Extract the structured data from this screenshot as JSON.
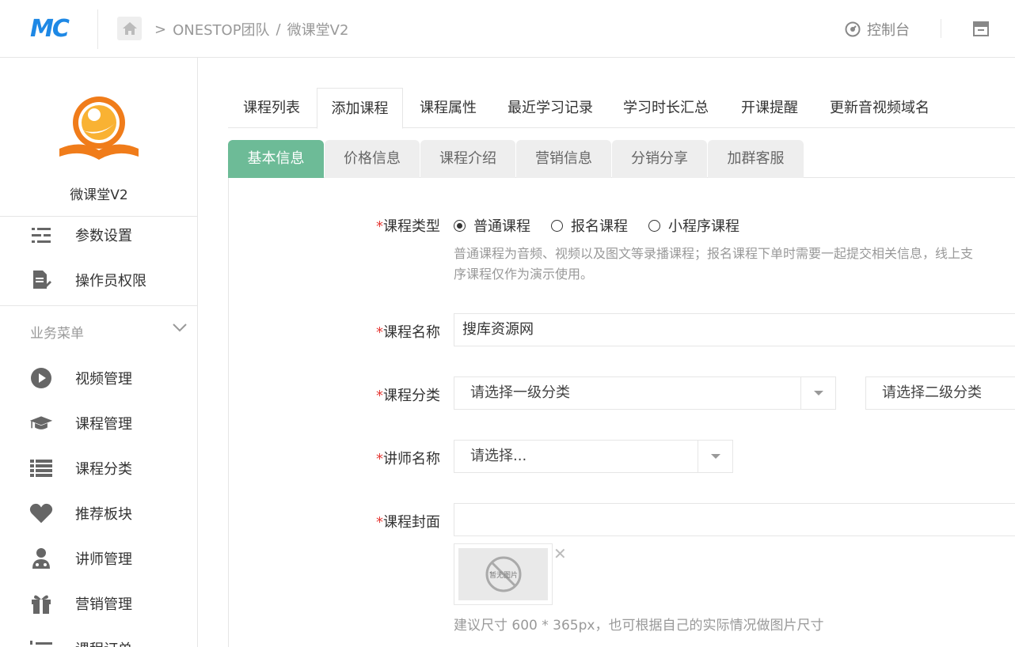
{
  "header": {
    "logo_text": "MC",
    "breadcrumb": [
      "ONESTOP团队",
      "微课堂V2"
    ],
    "breadcrumb_sep": ">",
    "breadcrumb_sep2": "/",
    "control_label": "控制台"
  },
  "sidebar": {
    "brand_name": "微课堂V2",
    "top_items": [
      {
        "label": "参数设置",
        "icon": "sliders-icon"
      },
      {
        "label": "操作员权限",
        "icon": "document-edit-icon"
      }
    ],
    "group_label": "业务菜单",
    "items": [
      {
        "label": "视频管理",
        "icon": "play-circle-icon"
      },
      {
        "label": "课程管理",
        "icon": "graduation-cap-icon"
      },
      {
        "label": "课程分类",
        "icon": "list-icon"
      },
      {
        "label": "推荐板块",
        "icon": "heart-icon"
      },
      {
        "label": "讲师管理",
        "icon": "teacher-icon"
      },
      {
        "label": "营销管理",
        "icon": "gift-icon"
      },
      {
        "label": "课程订单",
        "icon": "ordered-list-icon"
      }
    ]
  },
  "tabs": [
    "课程列表",
    "添加课程",
    "课程属性",
    "最近学习记录",
    "学习时长汇总",
    "开课提醒",
    "更新音视频域名"
  ],
  "active_tab": "添加课程",
  "subtabs": [
    "基本信息",
    "价格信息",
    "课程介绍",
    "营销信息",
    "分销分享",
    "加群客服"
  ],
  "active_subtab": "基本信息",
  "form": {
    "required_mark": "*",
    "type_label": "课程类型",
    "type_options": [
      "普通课程",
      "报名课程",
      "小程序课程"
    ],
    "type_selected": "普通课程",
    "type_help_1": "普通课程为音频、视频以及图文等录播课程；报名课程下单时需要一起提交相关信息，线上支",
    "type_help_2": "序课程仅作为演示使用。",
    "name_label": "课程名称",
    "name_value": "搜库资源网",
    "category_label": "课程分类",
    "category_1_placeholder": "请选择一级分类",
    "category_2_placeholder": "请选择二级分类",
    "teacher_label": "讲师名称",
    "teacher_placeholder": "请选择...",
    "cover_label": "课程封面",
    "cover_value": "",
    "no_image_text": "暂无图片",
    "cover_help": "建议尺寸 600 * 365px，也可根据自己的实际情况做图片尺寸",
    "close_symbol": "✕"
  },
  "colors": {
    "accent_green": "#6dbb97",
    "required_red": "#e53935",
    "logo_blue": "#1e88e5",
    "brand_orange": "#f07c1a"
  }
}
